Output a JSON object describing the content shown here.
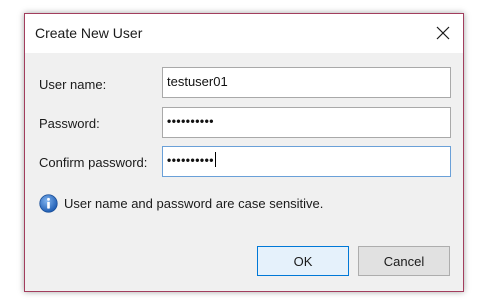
{
  "dialog": {
    "title": "Create New User"
  },
  "form": {
    "username_label": "User name:",
    "username_value": "testuser01",
    "password_label": "Password:",
    "password_value": "••••••••••",
    "confirm_label": "Confirm password:",
    "confirm_value": "••••••••••"
  },
  "info": {
    "message": "User name and password are case sensitive."
  },
  "buttons": {
    "ok": "OK",
    "cancel": "Cancel"
  },
  "colors": {
    "dialog_border": "#a23d5d",
    "dialog_bg": "#f0f0f0",
    "focus_border": "#6aa0d8",
    "default_button_border": "#0078d7",
    "info_icon": "#2f6fc4"
  }
}
